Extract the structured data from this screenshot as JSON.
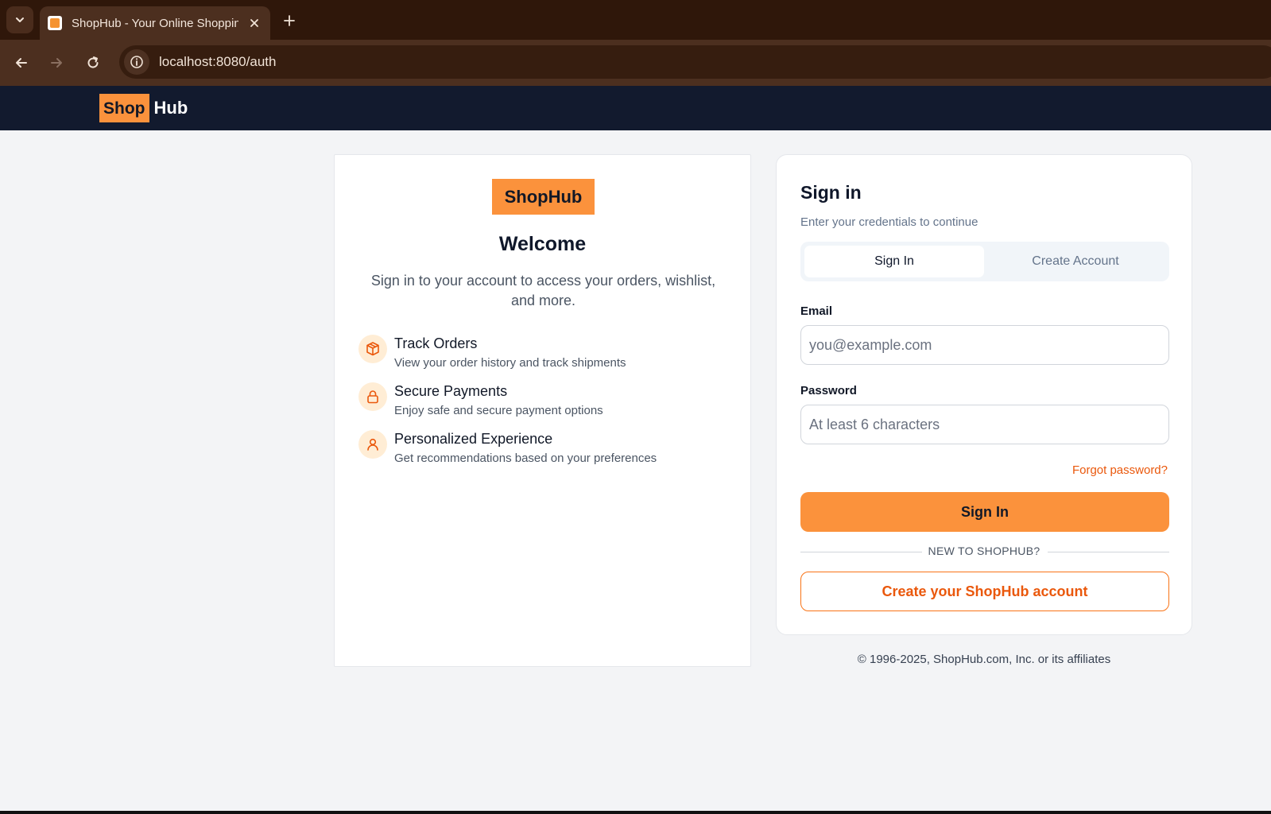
{
  "browser": {
    "tab_title": "ShopHub - Your Online Shopping",
    "url": "localhost:8080/auth"
  },
  "header": {
    "logo_shop": "Shop",
    "logo_hub": "Hub"
  },
  "intro": {
    "logo": "ShopHub",
    "title": "Welcome",
    "subtitle": "Sign in to your account to access your orders, wishlist, and more.",
    "features": [
      {
        "icon": "package-icon",
        "title": "Track Orders",
        "description": "View your order history and track shipments"
      },
      {
        "icon": "lock-icon",
        "title": "Secure Payments",
        "description": "Enjoy safe and secure payment options"
      },
      {
        "icon": "user-icon",
        "title": "Personalized Experience",
        "description": "Get recommendations based on your preferences"
      }
    ]
  },
  "signin": {
    "title": "Sign in",
    "subtitle": "Enter your credentials to continue",
    "tabs": [
      {
        "label": "Sign In",
        "active": true
      },
      {
        "label": "Create Account",
        "active": false
      }
    ],
    "email_label": "Email",
    "email_placeholder": "you@example.com",
    "email_value": "",
    "password_label": "Password",
    "password_placeholder": "At least 6 characters",
    "password_value": "",
    "forgot_label": "Forgot password?",
    "submit_label": "Sign In",
    "divider_text": "NEW TO SHOPHUB?",
    "create_label": "Create your ShopHub account"
  },
  "footer": {
    "copyright": "© 1996-2025, ShopHub.com, Inc. or its affiliates"
  },
  "colors": {
    "accent": "#fb923c",
    "accent_text": "#ea580c",
    "header_bg": "#121a2e",
    "page_bg": "#f3f4f6"
  }
}
